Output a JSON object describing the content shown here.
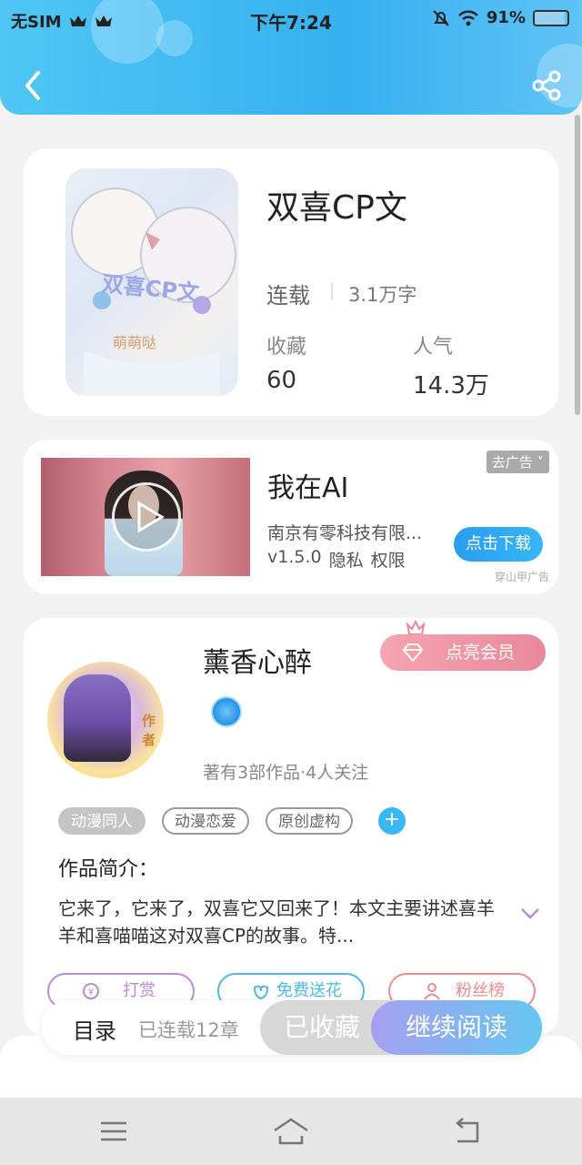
{
  "status_bar": {
    "carrier": "无SIM",
    "time": "下午7:24",
    "battery": "91%"
  },
  "book": {
    "title": "双喜CP文",
    "status": "连载",
    "word_count": "3.1万字",
    "favorites_label": "收藏",
    "favorites_value": "60",
    "popularity_label": "人气",
    "popularity_value": "14.3万",
    "cover_text": "双喜CP文",
    "cover_subtext": "萌萌哒"
  },
  "ad": {
    "title": "我在AI",
    "company": "南京有零科技有限...",
    "version": "v1.5.0",
    "privacy": "隐私",
    "permissions": "权限",
    "remove_label": "去广告",
    "download_label": "点击下载",
    "source": "穿山甲广告"
  },
  "author": {
    "name": "薰香心醉",
    "avatar_tag": "作者",
    "vip_label": "点亮会员",
    "info": "著有3部作品·4人关注",
    "tags": [
      "动漫同人",
      "动漫恋爱",
      "原创虚构"
    ],
    "tag_add": "+",
    "intro_label": "作品简介：",
    "intro_text": "它来了，它来了，双喜它又回来了！本文主要讲述喜羊羊和喜喵喵这对双喜CP的故事。特...",
    "actions": {
      "reward": "打赏",
      "flower": "免费送花",
      "fans": "粉丝榜"
    }
  },
  "bottom": {
    "toc_label": "目录",
    "toc_count": "已连载12章",
    "favorited_label": "已收藏",
    "continue_label": "继续阅读"
  },
  "colors": {
    "header": "#38b0f0",
    "accent_blue": "#39b8f5",
    "vip_pink": "#e8899b",
    "reward_purple": "#b88ad9",
    "flower_blue": "#4fb8e8",
    "fans_red": "#ef8a8a"
  }
}
